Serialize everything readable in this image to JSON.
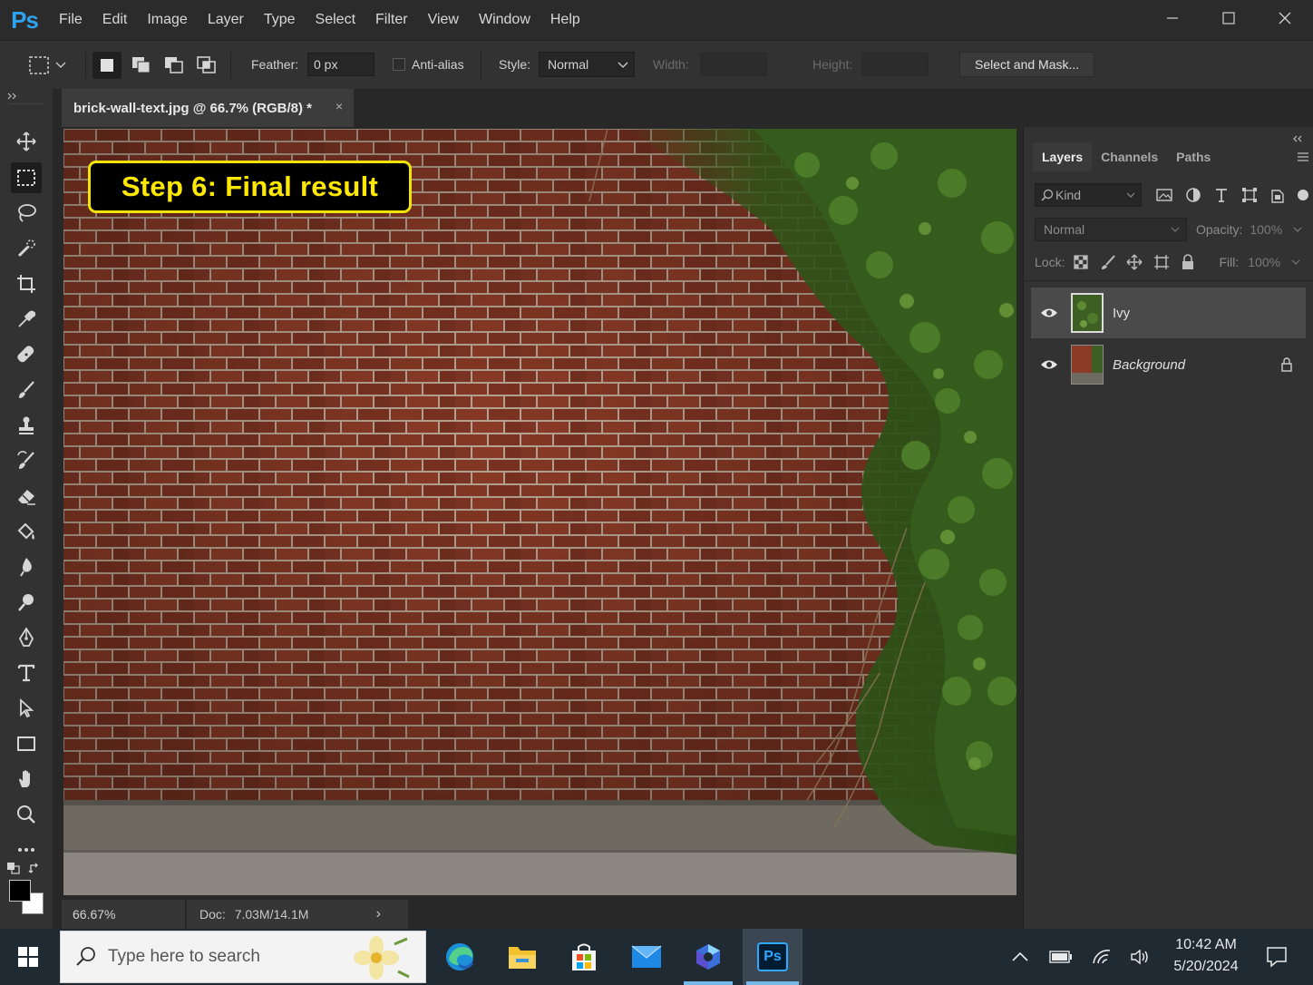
{
  "app": {
    "logo": "Ps",
    "menu": [
      "File",
      "Edit",
      "Image",
      "Layer",
      "Type",
      "Select",
      "Filter",
      "View",
      "Window",
      "Help"
    ],
    "window_controls": [
      "minimize-icon",
      "maximize-icon",
      "close-icon"
    ]
  },
  "options": {
    "feather_label": "Feather:",
    "feather_value": "0 px",
    "antialias_label": "Anti-alias",
    "antialias_checked": false,
    "style_label": "Style:",
    "style_value": "Normal",
    "width_label": "Width:",
    "height_label": "Height:",
    "select_mask_label": "Select and Mask..."
  },
  "document": {
    "tab_title": "brick-wall-text.jpg @ 66.7% (RGB/8) *",
    "close_glyph": "×",
    "callout_text": "Step 6: Final result"
  },
  "status": {
    "zoom": "66.67%",
    "doc_label": "Doc:",
    "doc_value": "7.03M/14.1M",
    "arrow": "›"
  },
  "tools": [
    "move-tool",
    "rectangular-marquee-tool",
    "lasso-tool",
    "quick-selection-tool",
    "crop-tool",
    "eyedropper-tool",
    "healing-brush-tool",
    "brush-tool",
    "clone-stamp-tool",
    "history-brush-tool",
    "eraser-tool",
    "paint-bucket-tool",
    "blur-tool",
    "dodge-tool",
    "pen-tool",
    "type-tool",
    "path-selection-tool",
    "rectangle-tool",
    "hand-tool",
    "zoom-tool",
    "more-tools"
  ],
  "layers_panel": {
    "tabs": [
      "Layers",
      "Channels",
      "Paths"
    ],
    "active_tab": "Layers",
    "filter_label": "Kind",
    "blend_mode": "Normal",
    "opacity_label": "Opacity:",
    "opacity_value": "100%",
    "lock_label": "Lock:",
    "fill_label": "Fill:",
    "fill_value": "100%",
    "layers": [
      {
        "name": "Ivy",
        "visible": true,
        "selected": true,
        "locked": false
      },
      {
        "name": "Background",
        "visible": true,
        "selected": false,
        "locked": true
      }
    ]
  },
  "taskbar": {
    "search_placeholder": "Type here to search",
    "apps": [
      "edge-icon",
      "file-explorer-icon",
      "store-icon",
      "mail-icon",
      "app-icon",
      "photoshop-icon"
    ],
    "ps_label": "Ps",
    "time": "10:42 AM",
    "date": "5/20/2024"
  },
  "colors": {
    "accent_blue": "#2fa3f0",
    "callout_yellow": "#ffe800",
    "brick": "#8a3b27",
    "ivy": "#3f6a23"
  }
}
